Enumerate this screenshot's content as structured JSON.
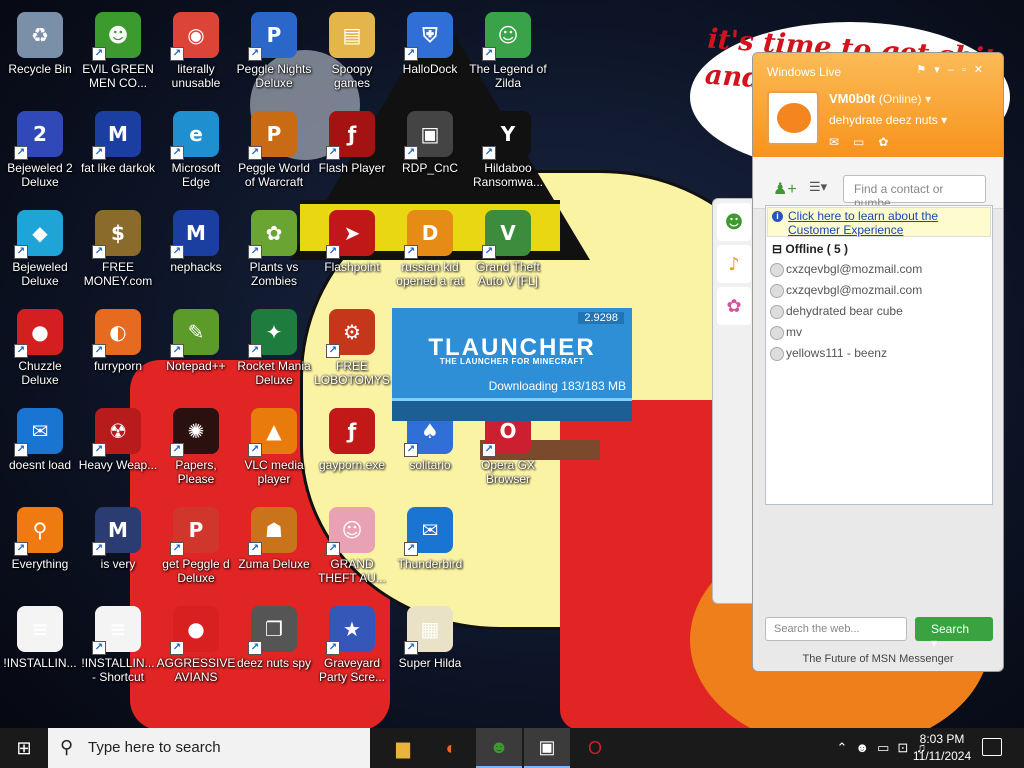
{
  "wallpaper": {
    "bubble_text": "it's time to get shit and or t"
  },
  "desktop_icons": [
    {
      "label": "Recycle Bin",
      "icon": "recycle-bin-icon",
      "color": "#7a8fa8",
      "shortcut": false,
      "glyph": "♻"
    },
    {
      "label": "EVIL GREEN MEN CO...",
      "icon": "msn-people-icon",
      "color": "#3c9a2e",
      "shortcut": true,
      "glyph": "☻"
    },
    {
      "label": "literally unusable",
      "icon": "chrome-icon",
      "color": "#db4437",
      "shortcut": true,
      "glyph": "◉"
    },
    {
      "label": "Peggle Nights Deluxe",
      "icon": "peggle-icon",
      "color": "#2b67c9",
      "shortcut": true,
      "glyph": "P"
    },
    {
      "label": "Spoopy games",
      "icon": "folder-icon",
      "color": "#e3b54a",
      "shortcut": false,
      "glyph": "▤"
    },
    {
      "label": "HalloDock",
      "icon": "windows-shield-icon",
      "color": "#2f6fd6",
      "shortcut": true,
      "glyph": "⛨"
    },
    {
      "label": "The Legend of Zilda",
      "icon": "zelda-icon",
      "color": "#3aa34a",
      "shortcut": true,
      "glyph": "☺"
    },
    {
      "label": "Bejeweled 2 Deluxe",
      "icon": "bejeweled2-icon",
      "color": "#3048b8",
      "shortcut": true,
      "glyph": "2"
    },
    {
      "label": "fat like darkok",
      "icon": "mpl-icon",
      "color": "#1b3fa0",
      "shortcut": true,
      "glyph": "M"
    },
    {
      "label": "Microsoft Edge",
      "icon": "edge-icon",
      "color": "#1f8fcf",
      "shortcut": true,
      "glyph": "e"
    },
    {
      "label": "Peggle World of Warcraft",
      "icon": "peggle-wow-icon",
      "color": "#c96b14",
      "shortcut": true,
      "glyph": "P"
    },
    {
      "label": "Flash Player",
      "icon": "flash-icon",
      "color": "#a51212",
      "shortcut": true,
      "glyph": "ƒ"
    },
    {
      "label": "RDP_CnC",
      "icon": "remote-desktop-icon",
      "color": "#444444",
      "shortcut": true,
      "glyph": "▣"
    },
    {
      "label": "Hildaboo Ransomwa...",
      "icon": "yashma-icon",
      "color": "#111111",
      "shortcut": true,
      "glyph": "Y"
    },
    {
      "label": "Bejeweled Deluxe",
      "icon": "bejeweled-gem-icon",
      "color": "#1fa4d8",
      "shortcut": true,
      "glyph": "◆"
    },
    {
      "label": "FREE MONEY.com",
      "icon": "money-bag-icon",
      "color": "#8a6b2c",
      "shortcut": true,
      "glyph": "$"
    },
    {
      "label": "nephacks",
      "icon": "mpi-icon",
      "color": "#1b3fa0",
      "shortcut": true,
      "glyph": "M"
    },
    {
      "label": "Plants vs Zombies",
      "icon": "plants-vs-zombies-icon",
      "color": "#6aa534",
      "shortcut": true,
      "glyph": "✿"
    },
    {
      "label": "Flashpoint",
      "icon": "flashpoint-icon",
      "color": "#c01818",
      "shortcut": true,
      "glyph": "➤"
    },
    {
      "label": "russian kid opened a rat",
      "icon": "de-icon",
      "color": "#e58b16",
      "shortcut": true,
      "glyph": "D"
    },
    {
      "label": "Grand Theft Auto V [FL]",
      "icon": "gta-icon",
      "color": "#3d8b3d",
      "shortcut": true,
      "glyph": "V"
    },
    {
      "label": "Chuzzle Deluxe",
      "icon": "chuzzle-icon",
      "color": "#d31f1f",
      "shortcut": true,
      "glyph": "●"
    },
    {
      "label": "furryporn",
      "icon": "firefox-icon",
      "color": "#e66a1f",
      "shortcut": true,
      "glyph": "◐"
    },
    {
      "label": "Notepad++",
      "icon": "notepadpp-icon",
      "color": "#5c9a2a",
      "shortcut": true,
      "glyph": "✎"
    },
    {
      "label": "Rocket Mania Deluxe",
      "icon": "rocket-mania-icon",
      "color": "#1d7c3e",
      "shortcut": true,
      "glyph": "✦"
    },
    {
      "label": "FREE LOBOTOMYS",
      "icon": "drill-icon",
      "color": "#c5361b",
      "shortcut": true,
      "glyph": "⚙"
    },
    {
      "label": "doesnt load",
      "icon": "thunderbird-icon",
      "color": "#1a74d1",
      "shortcut": true,
      "glyph": "✉"
    },
    {
      "label": "Heavy Weap...",
      "icon": "radiation-icon",
      "color": "#b81b1b",
      "shortcut": true,
      "glyph": "☢"
    },
    {
      "label": "Papers, Please",
      "icon": "papers-please-icon",
      "color": "#2b1010",
      "shortcut": true,
      "glyph": "✺"
    },
    {
      "label": "VLC media player",
      "icon": "vlc-icon",
      "color": "#e97b0d",
      "shortcut": true,
      "glyph": "▲"
    },
    {
      "label": "gayporn.exe",
      "icon": "flash-exe-icon",
      "color": "#c21818",
      "shortcut": false,
      "glyph": "ƒ"
    },
    {
      "label": "solitario",
      "icon": "cards-icon",
      "color": "#2f6fd6",
      "shortcut": true,
      "glyph": "♠"
    },
    {
      "label": "Opera GX Browser",
      "icon": "opera-gx-icon",
      "color": "#cc1f2f",
      "shortcut": true,
      "glyph": "O"
    },
    {
      "label": "Everything",
      "icon": "everything-search-icon",
      "color": "#f07a12",
      "shortcut": true,
      "glyph": "⚲"
    },
    {
      "label": "is very",
      "icon": "mpl-shield-icon",
      "color": "#2a3c72",
      "shortcut": true,
      "glyph": "M"
    },
    {
      "label": "get Peggle d Deluxe",
      "icon": "peggle-deluxe-icon",
      "color": "#d1362d",
      "shortcut": true,
      "glyph": "P"
    },
    {
      "label": "Zuma Deluxe",
      "icon": "zuma-icon",
      "color": "#c9741a",
      "shortcut": true,
      "glyph": "☗"
    },
    {
      "label": "GRAND THEFT AU...",
      "icon": "anime-girl-icon",
      "color": "#e9a1b4",
      "shortcut": true,
      "glyph": "☺"
    },
    {
      "label": "Thunderbird",
      "icon": "thunderbird-icon",
      "color": "#1a74d1",
      "shortcut": true,
      "glyph": "✉"
    },
    {
      "label": "!INSTALLIN...",
      "icon": "text-file-icon",
      "color": "#f4f4f4",
      "shortcut": false,
      "glyph": "≡"
    },
    {
      "label": "!INSTALLIN... - Shortcut",
      "icon": "text-file-shortcut-icon",
      "color": "#f4f4f4",
      "shortcut": true,
      "glyph": "≡"
    },
    {
      "label": "AGGRESSIVE AVIANS",
      "icon": "angry-birds-icon",
      "color": "#d82020",
      "shortcut": true,
      "glyph": "●"
    },
    {
      "label": "deez nuts spy",
      "icon": "windows-stack-icon",
      "color": "#555555",
      "shortcut": true,
      "glyph": "❐"
    },
    {
      "label": "Graveyard Party Scre...",
      "icon": "voted-sticker-icon",
      "color": "#3557b8",
      "shortcut": true,
      "glyph": "★"
    },
    {
      "label": "Super Hilda",
      "icon": "pixel-dog-icon",
      "color": "#e9e2c6",
      "shortcut": true,
      "glyph": "▦"
    }
  ],
  "tlauncher": {
    "version": "2.9298",
    "title": "TLAUNCHER",
    "subtitle": "THE LAUNCHER FOR MINECRAFT",
    "status": "Downloading 183/183 MB",
    "progress": 1.0
  },
  "messenger": {
    "brand": "Windows Live",
    "username": "VM0b0t",
    "status": "(Online)",
    "personal_message": "dehydrate deez nuts",
    "find_placeholder": "Find a contact or numbe",
    "banner_line1": "Click here to learn about the",
    "banner_line2": "Customer Experience",
    "group_label": "Offline ( 5 )",
    "contacts": [
      "cxzqevbgl@mozmail.com",
      "cxzqevbgl@mozmail.com",
      "dehydrated bear cube",
      "mv",
      "yellows111 - beenz"
    ],
    "web_search_placeholder": "Search the web...",
    "search_button": "Search",
    "footer": "The Future of MSN Messenger"
  },
  "taskbar": {
    "search_placeholder": "Type here to search",
    "apps": [
      {
        "name": "file-explorer-icon",
        "glyph": "▆",
        "color": "#e8b53a",
        "active": false
      },
      {
        "name": "firefox-icon",
        "glyph": "◐",
        "color": "#e66a1f",
        "active": false
      },
      {
        "name": "msn-messenger-icon",
        "glyph": "☻",
        "color": "#3c9a2e",
        "active": true
      },
      {
        "name": "tlauncher-icon",
        "glyph": "▣",
        "color": "#ffffff",
        "active": true
      },
      {
        "name": "opera-icon",
        "glyph": "O",
        "color": "#cc1f2f",
        "active": false
      }
    ],
    "time": "8:03 PM",
    "date": "11/11/2024"
  }
}
